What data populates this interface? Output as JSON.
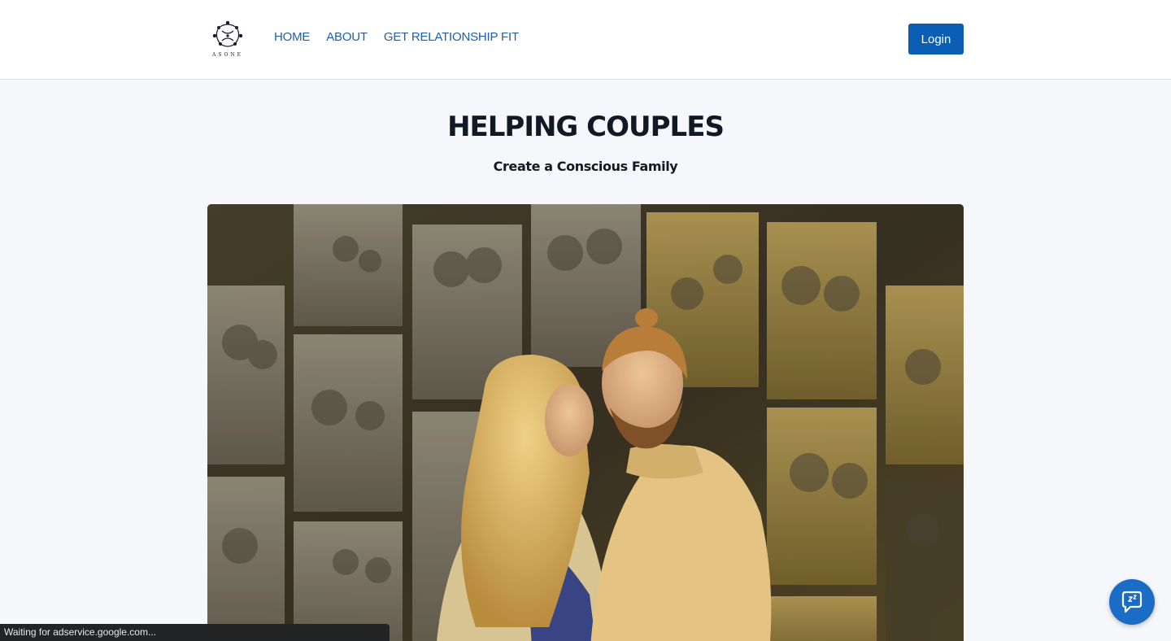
{
  "nav": {
    "logo_text": "ASONE",
    "links": [
      "HOME",
      "ABOUT",
      "GET RELATIONSHIP FIT"
    ],
    "login_label": "Login"
  },
  "hero": {
    "title": "HELPING COUPLES",
    "subtitle": "Create a Conscious Family",
    "image_icon": "couple-collage-photo"
  },
  "browser_status": "Waiting for adservice.google.com...",
  "chat": {
    "icon": "chat-bubble-icon"
  },
  "colors": {
    "accent": "#0a5fb4",
    "nav_link": "#1f5fa8",
    "page_bg": "#f5f7fa",
    "title": "#111a24"
  }
}
